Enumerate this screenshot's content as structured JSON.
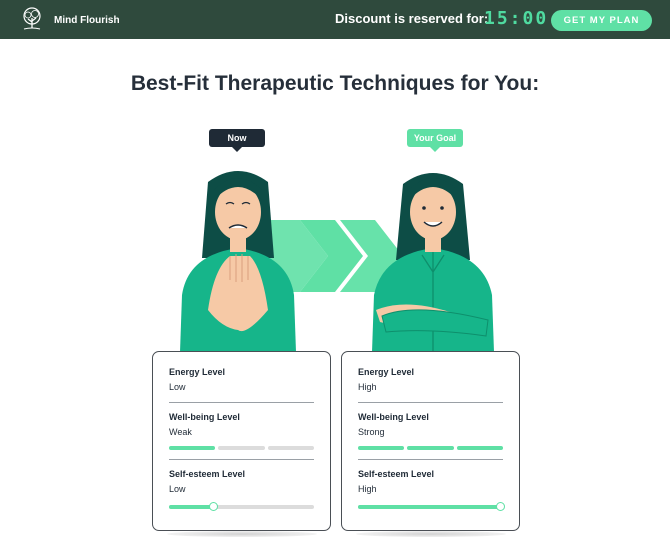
{
  "header": {
    "brand_name": "Mind Flourish",
    "logo_icon": "tree-icon",
    "discount_text": "Discount is reserved for:",
    "timer": "15:00",
    "cta_label": "GET MY PLAN"
  },
  "main": {
    "title": "Best-Fit Therapeutic Techniques for You:",
    "tags": {
      "now": "Now",
      "goal": "Your Goal"
    }
  },
  "cards": {
    "now": {
      "energy": {
        "label": "Energy Level",
        "value": "Low"
      },
      "wellbeing": {
        "label": "Well-being Level",
        "value": "Weak",
        "segments_filled": 1,
        "segments_total": 3
      },
      "selfesteem": {
        "label": "Self-esteem Level",
        "value": "Low",
        "level_fraction": 0.3
      }
    },
    "goal": {
      "energy": {
        "label": "Energy Level",
        "value": "High"
      },
      "wellbeing": {
        "label": "Well-being Level",
        "value": "Strong",
        "segments_filled": 3,
        "segments_total": 3
      },
      "selfesteem": {
        "label": "Self-esteem Level",
        "value": "High",
        "level_fraction": 0.98
      }
    }
  },
  "colors": {
    "header_bg": "#2f4a3d",
    "accent": "#5fe0a5",
    "dark": "#1f2a36",
    "shirt": "#16b58a",
    "hair": "#0d4d46"
  }
}
